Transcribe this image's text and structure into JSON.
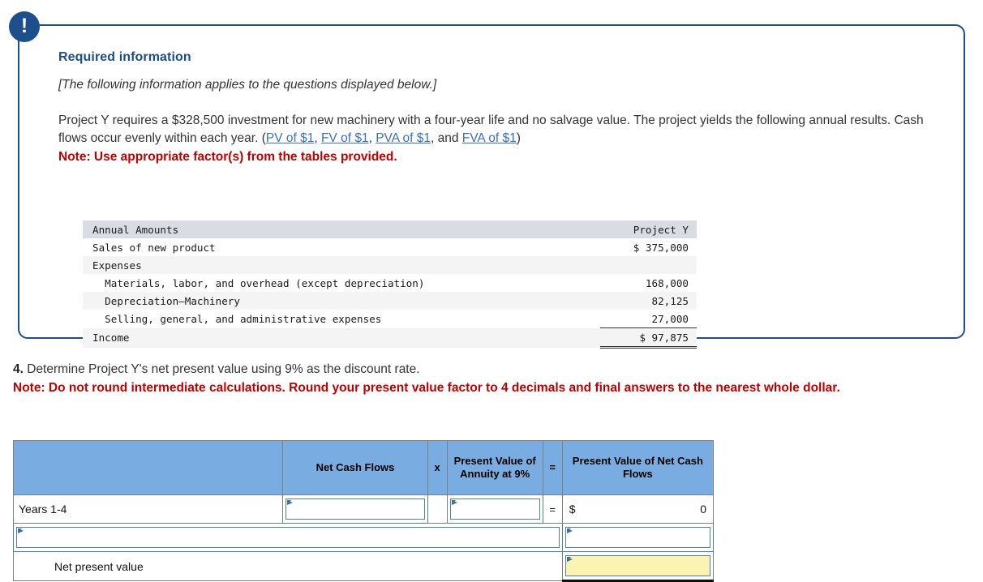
{
  "alert": {
    "icon": "exclamation-icon",
    "glyph": "!"
  },
  "panel": {
    "heading": "Required information",
    "italic_note": "[The following information applies to the questions displayed below.]",
    "body_part1": "Project Y requires a $328,500 investment for new machinery with a four-year life and no salvage value. The project yields the following annual results. Cash flows occur evenly within each year. (",
    "links": [
      {
        "label": "PV of $1"
      },
      {
        "label": "FV of $1"
      },
      {
        "label": "PVA of $1"
      },
      {
        "label": "FVA of $1"
      }
    ],
    "sep1": ", ",
    "sep2": ", ",
    "sep3": ", and ",
    "body_close": ")",
    "red_note": "Note: Use appropriate factor(s) from the tables provided."
  },
  "amounts_table": {
    "header": {
      "label": "Annual Amounts",
      "value": "Project Y"
    },
    "rows": [
      {
        "label": "Sales of new product",
        "value": "$ 375,000"
      },
      {
        "label": "Expenses",
        "value": ""
      },
      {
        "label": "  Materials, labor, and overhead (except depreciation)",
        "value": "168,000"
      },
      {
        "label": "  Depreciation—Machinery",
        "value": "82,125"
      },
      {
        "label": "  Selling, general, and administrative expenses",
        "value": "27,000"
      },
      {
        "label": "Income",
        "value": "$ 97,875"
      }
    ]
  },
  "question": {
    "number": "4.",
    "text": " Determine Project Y's net present value using 9% as the discount rate.",
    "note": "Note: Do not round intermediate calculations. Round your present value factor to 4 decimals and final answers to the nearest whole dollar."
  },
  "answer_table": {
    "headers": {
      "blank": "",
      "net_cash_flows": "Net Cash Flows",
      "times": "x",
      "pv_annuity": "Present Value of Annuity at 9%",
      "equals": "=",
      "pv_net_cash_flows": "Present Value of Net Cash Flows"
    },
    "rows": [
      {
        "label": "Years 1-4",
        "net_cash_flows_value": "",
        "pv_annuity_value": "",
        "equals": "=",
        "dollar": "$",
        "result": "0"
      },
      {
        "label": "",
        "result_value": ""
      },
      {
        "label": "Net present value",
        "result_value": ""
      }
    ]
  },
  "colors": {
    "panel_border": "#1b4f8a",
    "heading_blue": "#1b4f8a",
    "link_blue": "#3b6fc4",
    "note_red": "#c00000",
    "table_header_blue": "#79ace0",
    "amounts_header_grey": "#d9dce3",
    "input_border": "#4a7ebb",
    "highlight_yellow": "#fbf3b2"
  }
}
